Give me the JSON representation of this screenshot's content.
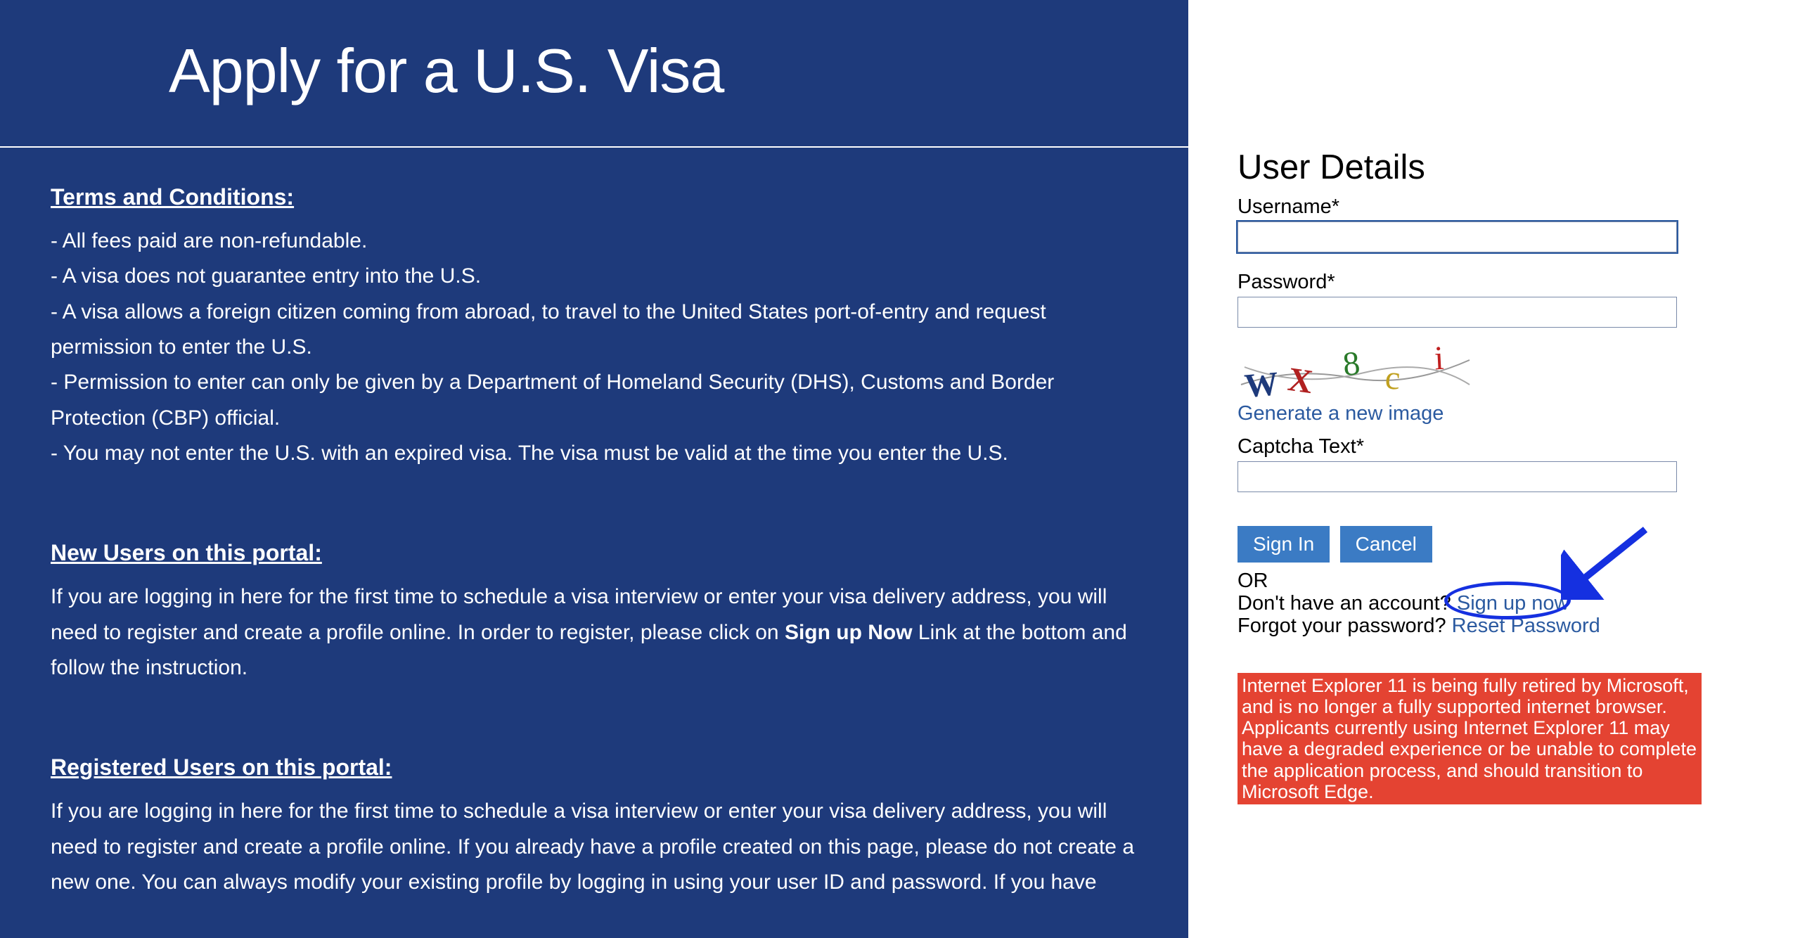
{
  "header": {
    "title": "Apply for a U.S. Visa"
  },
  "terms": {
    "heading": "Terms and Conditions:",
    "items": [
      "- All fees paid are non-refundable.",
      "- A visa does not guarantee entry into the U.S.",
      "- A visa allows a foreign citizen coming from abroad, to travel to the United States port-of-entry and request permission to enter the U.S.",
      "- Permission to enter can only be given by a Department of Homeland Security (DHS), Customs and Border Protection (CBP) official.",
      "- You may not enter the U.S. with an expired visa. The visa must be valid at the time you enter the U.S."
    ]
  },
  "newUsers": {
    "heading": "New Users on this portal:",
    "paragraph_before": "If you are logging in here for the first time to schedule a visa interview or enter your visa delivery address, you will need to register and create a profile online. In order to register, please click on ",
    "bold": "Sign up Now",
    "paragraph_after": " Link at the bottom and follow the instruction."
  },
  "registeredUsers": {
    "heading": "Registered Users on this portal:",
    "paragraph": "If you are logging in here for the first time to schedule a visa interview or enter your visa delivery address, you will need to register and create a profile online. If you already have a profile created on this page, please do not create a new one. You can always modify your existing profile by logging in using your user ID and password. If you have"
  },
  "userDetails": {
    "heading": "User Details",
    "usernameLabel": "Username*",
    "passwordLabel": "Password*",
    "generateLink": "Generate a new image",
    "captchaLabel": "Captcha Text*",
    "signInBtn": "Sign In",
    "cancelBtn": "Cancel",
    "orText": "OR",
    "noAccountText": "Don't have an account? ",
    "signUpLink": "Sign up now",
    "forgotText": "Forgot your password? ",
    "resetLink": "Reset Password",
    "warningText": "Internet Explorer 11 is being fully retired by Microsoft, and is no longer a fully supported internet browser. Applicants currently using Internet Explorer 11 may have a degraded experience or be unable to complete the application process, and should transition to Microsoft Edge."
  }
}
